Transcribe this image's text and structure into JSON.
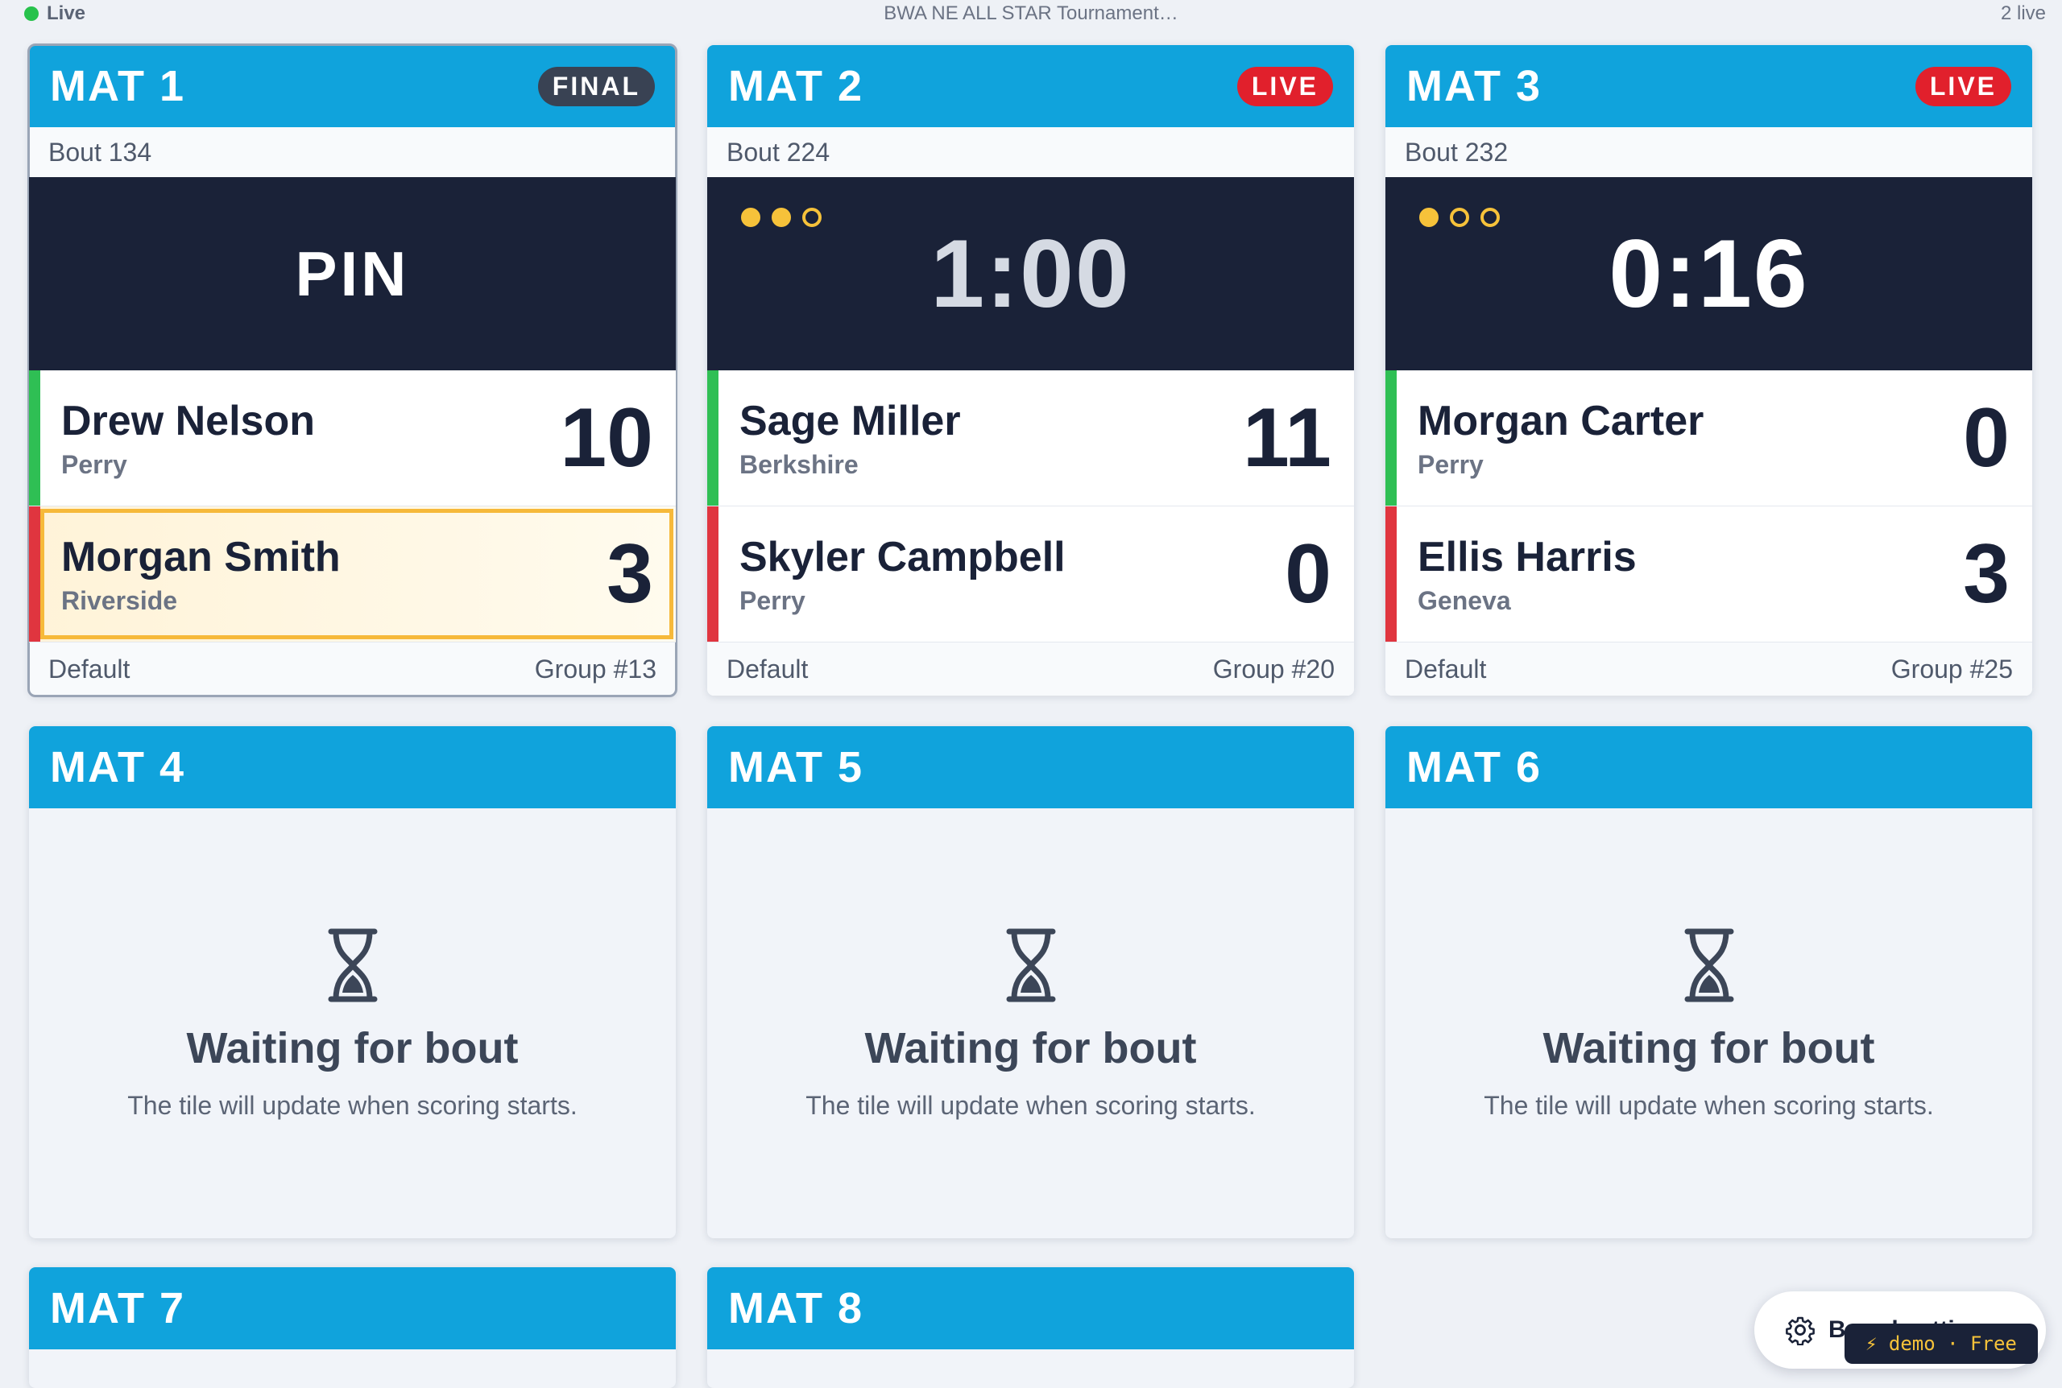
{
  "topbar": {
    "live_label": "Live",
    "title": "BWA NE ALL STAR Tournament…",
    "live_count": "2 live"
  },
  "colors": {
    "accent": "#10a3dc",
    "final_badge": "#394253",
    "live_badge": "#e1202c",
    "green_corner": "#2fbf54",
    "red_corner": "#e0353f",
    "period_dot": "#f6c23a"
  },
  "mats": [
    {
      "label": "MAT 1",
      "status": "FINAL",
      "bout": "Bout 134",
      "result": "PIN",
      "top": {
        "name": "Drew Nelson",
        "team": "Perry",
        "score": "10"
      },
      "bottom": {
        "name": "Morgan Smith",
        "team": "Riverside",
        "score": "3"
      },
      "footer_left": "Default",
      "footer_right": "Group #13"
    },
    {
      "label": "MAT 2",
      "status": "LIVE",
      "bout": "Bout 224",
      "clock": "1:00",
      "period": 2,
      "periods_total": 3,
      "top": {
        "name": "Sage Miller",
        "team": "Berkshire",
        "score": "11"
      },
      "bottom": {
        "name": "Skyler Campbell",
        "team": "Perry",
        "score": "0"
      },
      "footer_left": "Default",
      "footer_right": "Group #20"
    },
    {
      "label": "MAT 3",
      "status": "LIVE",
      "bout": "Bout 232",
      "clock": "0:16",
      "period": 1,
      "periods_total": 3,
      "top": {
        "name": "Morgan Carter",
        "team": "Perry",
        "score": "0"
      },
      "bottom": {
        "name": "Ellis Harris",
        "team": "Geneva",
        "score": "3"
      },
      "footer_left": "Default",
      "footer_right": "Group #25"
    },
    {
      "label": "MAT 4"
    },
    {
      "label": "MAT 5"
    },
    {
      "label": "MAT 6"
    },
    {
      "label": "MAT 7"
    },
    {
      "label": "MAT 8"
    }
  ],
  "waiting": {
    "title": "Waiting for bout",
    "subtitle": "The tile will update when scoring starts."
  },
  "settings": {
    "label": "Board settings",
    "icon": "gear-icon"
  },
  "demo": {
    "label": "⚡ demo · Free"
  }
}
